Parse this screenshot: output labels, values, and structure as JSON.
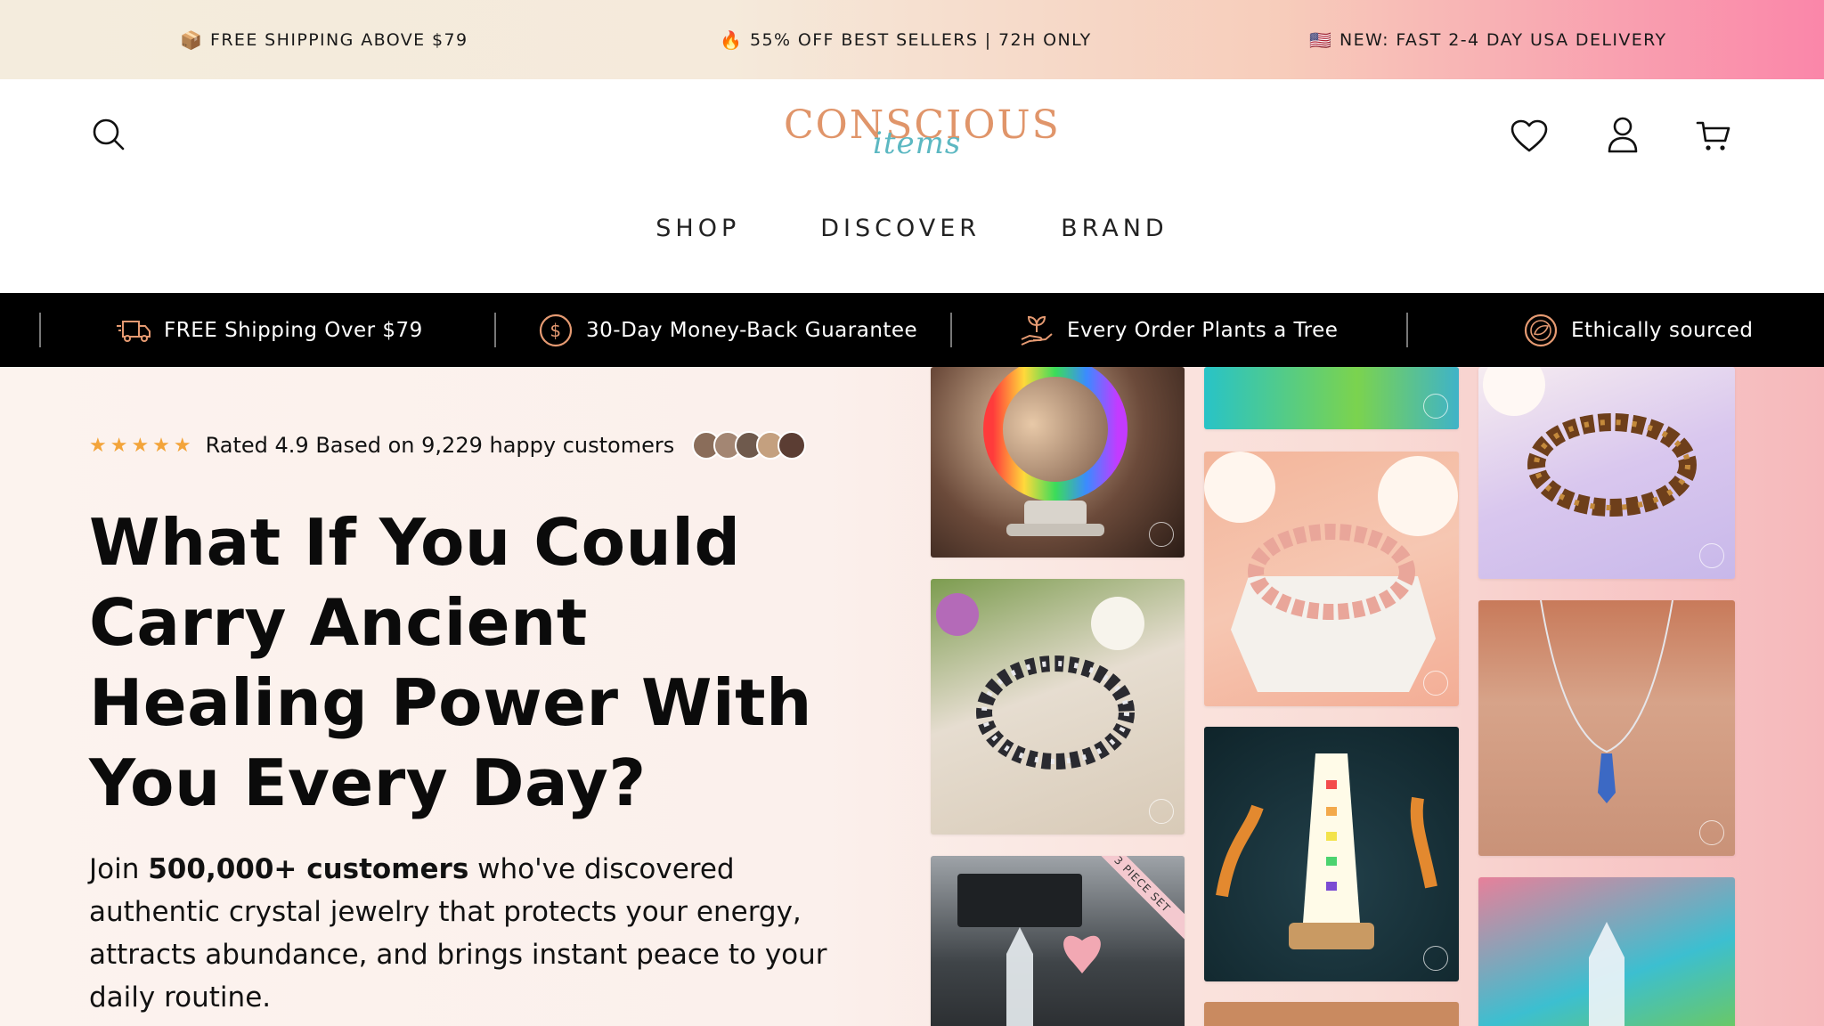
{
  "announcement": {
    "items": [
      {
        "icon": "package-icon",
        "glyph": "📦",
        "text": "FREE SHIPPING ABOVE $79"
      },
      {
        "icon": "fire-icon",
        "glyph": "🔥",
        "text": "55% OFF BEST SELLERS | 72H ONLY"
      },
      {
        "icon": "us-flag-icon",
        "glyph": "🇺🇸",
        "text": "NEW: FAST 2-4 DAY USA DELIVERY"
      }
    ]
  },
  "header": {
    "logo_main": "CONSCIOUS",
    "logo_script": "items",
    "nav": [
      "SHOP",
      "DISCOVER",
      "BRAND"
    ]
  },
  "trust_bar": {
    "items": [
      {
        "icon": "delivery-truck-icon",
        "text": "FREE Shipping Over $79"
      },
      {
        "icon": "dollar-coin-icon",
        "text": "30-Day Money-Back Guarantee"
      },
      {
        "icon": "plant-hand-icon",
        "text": "Every Order Plants a Tree"
      },
      {
        "icon": "globe-leaf-icon",
        "text": "Ethically sourced"
      }
    ]
  },
  "hero": {
    "rating_text": "Rated 4.9 Based on 9,229 happy customers",
    "rating_value": 4.9,
    "stars": "★★★★★",
    "headline": "What If You Could Carry Ancient Healing Power With You Every Day?",
    "sub_pre": "Join ",
    "sub_bold": "500,000+ customers",
    "sub_post": " who've discovered authentic crystal jewelry that protects your energy, attracts abundance, and brings instant peace to your daily routine.",
    "badge_text": "3 PIECE SET"
  },
  "colors": {
    "accent": "#e0956a",
    "logo_script": "#5cb8c2",
    "star": "#f3a43a",
    "trust_bg": "#000000"
  }
}
